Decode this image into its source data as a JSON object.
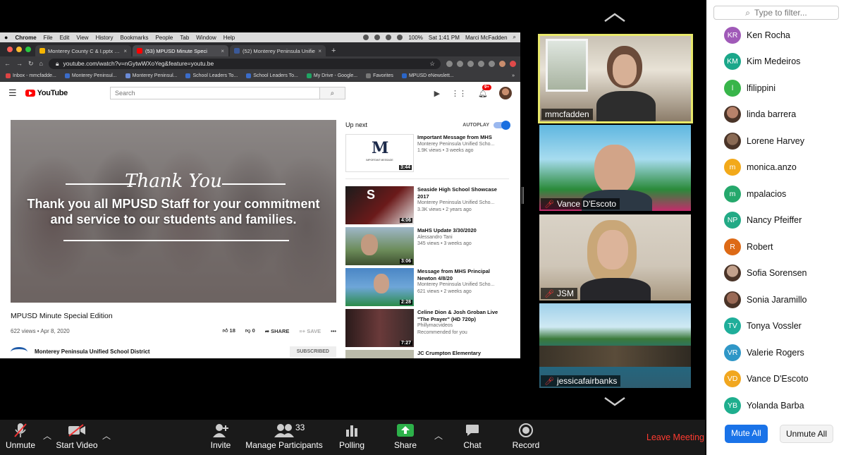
{
  "mac_menu": {
    "app": "Chrome",
    "items": [
      "File",
      "Edit",
      "View",
      "History",
      "Bookmarks",
      "People",
      "Tab",
      "Window",
      "Help"
    ],
    "battery": "100%",
    "clock": "Sat 1:41 PM",
    "user": "Marci McFadden"
  },
  "browser": {
    "tabs": [
      {
        "label": "Monterey County C & I.pptx - F",
        "color": "#f4b400"
      },
      {
        "label": "(53) MPUSD Minute Speci",
        "color": "#ff0000"
      },
      {
        "label": "(52) Monterey Peninsula Unifie",
        "color": "#3b5998"
      }
    ],
    "new_tab": "+",
    "url": "youtube.com/watch?v=nGytwWXoYeg&feature=youtu.be",
    "bookmarks": [
      "Inbox - mmcfadde...",
      "Monterey Peninsul...",
      "Monterey Peninsul...",
      "School Leaders To...",
      "School Leaders To...",
      "My Drive - Google...",
      "Favorites",
      "MPUSD eNewslett..."
    ],
    "bookmarks_more": "»"
  },
  "youtube": {
    "logo": "YouTube",
    "search_placeholder": "Search",
    "notif_count": "9+",
    "video": {
      "script_text": "Thank You",
      "overlay_text": "Thank you all MPUSD Staff for your commitment and service to our students and families.",
      "title": "MPUSD Minute Special Edition",
      "views": "622 views • Apr 8, 2020",
      "likes": "18",
      "dislikes": "0",
      "share": "SHARE",
      "save": "SAVE",
      "more": "•••",
      "channel": "Monterey Peninsula Unified School District",
      "subscribe": "SUBSCRIBED"
    },
    "up_next": "Up next",
    "autoplay": "AUTOPLAY",
    "recommendations": [
      {
        "title": "Important Message from MHS",
        "channel": "Monterey Peninsula Unified Scho...",
        "meta": "1.9K views • 3 weeks ago",
        "duration": "3:44",
        "thumb_letter": "M",
        "thumb_caption": "IMPORTANT MESSAGE"
      },
      {
        "title": "Seaside High School Showcase 2017",
        "channel": "Monterey Peninsula Unified Scho...",
        "meta": "3.3K views • 2 years ago",
        "duration": "4:06",
        "thumb_letter": "S"
      },
      {
        "title": "MaHS Update 3/30/2020",
        "channel": "Alessandro Tani",
        "meta": "345 views • 3 weeks ago",
        "duration": "3:06"
      },
      {
        "title": "Message from MHS Principal Newton 4/8/20",
        "channel": "Monterey Peninsula Unified Scho...",
        "meta": "621 views • 2 weeks ago",
        "duration": "2:28"
      },
      {
        "title": "Celine Dion & Josh Groban Live \"The Prayer\" (HD 720p)",
        "channel": "Phillymacvideos",
        "meta": "Recommended for you",
        "duration": "7:27"
      },
      {
        "title": "JC Crumpton Elementary",
        "channel": "",
        "meta": "",
        "duration": ""
      }
    ]
  },
  "gallery": {
    "tiles": [
      {
        "name": "mmcfadden",
        "muted": false
      },
      {
        "name": "Vance D'Escoto",
        "muted": true
      },
      {
        "name": "JSM",
        "muted": true
      },
      {
        "name": "jessicafairbanks",
        "muted": true
      }
    ]
  },
  "participants": {
    "filter_placeholder": "Type to filter...",
    "list": [
      {
        "name": "Ken Rocha",
        "initials": "KR",
        "color": "#a05ab8"
      },
      {
        "name": "Kim Medeiros",
        "initials": "KM",
        "color": "#1ba78a"
      },
      {
        "name": "lfilippini",
        "initials": "l",
        "color": "#38b54a"
      },
      {
        "name": "linda barrera",
        "initials": "",
        "color": "#b7826a",
        "photo": true
      },
      {
        "name": "Lorene Harvey",
        "initials": "",
        "color": "#8a6a54",
        "photo": true
      },
      {
        "name": "monica.anzo",
        "initials": "m",
        "color": "#f2a91a"
      },
      {
        "name": "mpalacios",
        "initials": "m",
        "color": "#25a86c"
      },
      {
        "name": "Nancy Pfeiffer",
        "initials": "NP",
        "color": "#23aa86"
      },
      {
        "name": "Robert",
        "initials": "R",
        "color": "#dd6a16"
      },
      {
        "name": "Sofia Sorensen",
        "initials": "",
        "color": "#c2a18c",
        "photo": true
      },
      {
        "name": "Sonia Jaramillo",
        "initials": "",
        "color": "#9a6a56",
        "photo": true
      },
      {
        "name": "Tonya Vossler",
        "initials": "TV",
        "color": "#1fae9a"
      },
      {
        "name": "Valerie Rogers",
        "initials": "VR",
        "color": "#2f97c7"
      },
      {
        "name": "Vance D'Escoto",
        "initials": "VD",
        "color": "#f1a720"
      },
      {
        "name": "Yolanda Barba",
        "initials": "YB",
        "color": "#1fae8e"
      }
    ],
    "mute_all": "Mute All",
    "unmute_all": "Unmute All"
  },
  "toolbar": {
    "unmute": "Unmute",
    "start_video": "Start Video",
    "invite": "Invite",
    "manage_participants": "Manage Participants",
    "participant_count": "33",
    "polling": "Polling",
    "share": "Share",
    "chat": "Chat",
    "record": "Record",
    "leave": "Leave Meeting"
  }
}
